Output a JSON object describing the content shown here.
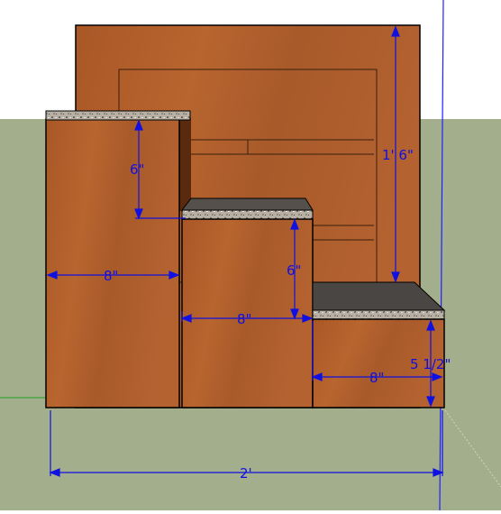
{
  "scene": {
    "sky_color": "#ffffff",
    "ground_color": "#a3ae8c",
    "wood_color": "#b25f2b",
    "wood_dark": "#8e4a20",
    "granite_color": "#bdb5ab",
    "dimension_color": "#1010e0",
    "edge_color": "#000000"
  },
  "dimensions": {
    "upper_step_height": "6\"",
    "upper_step_depth": "8\"",
    "middle_step_height": "6\"",
    "middle_step_depth": "8\"",
    "back_wall_height": "1' 6\"",
    "lower_step_height": "5 1/2\"",
    "lower_step_depth": "8\"",
    "overall_width": "2'"
  }
}
